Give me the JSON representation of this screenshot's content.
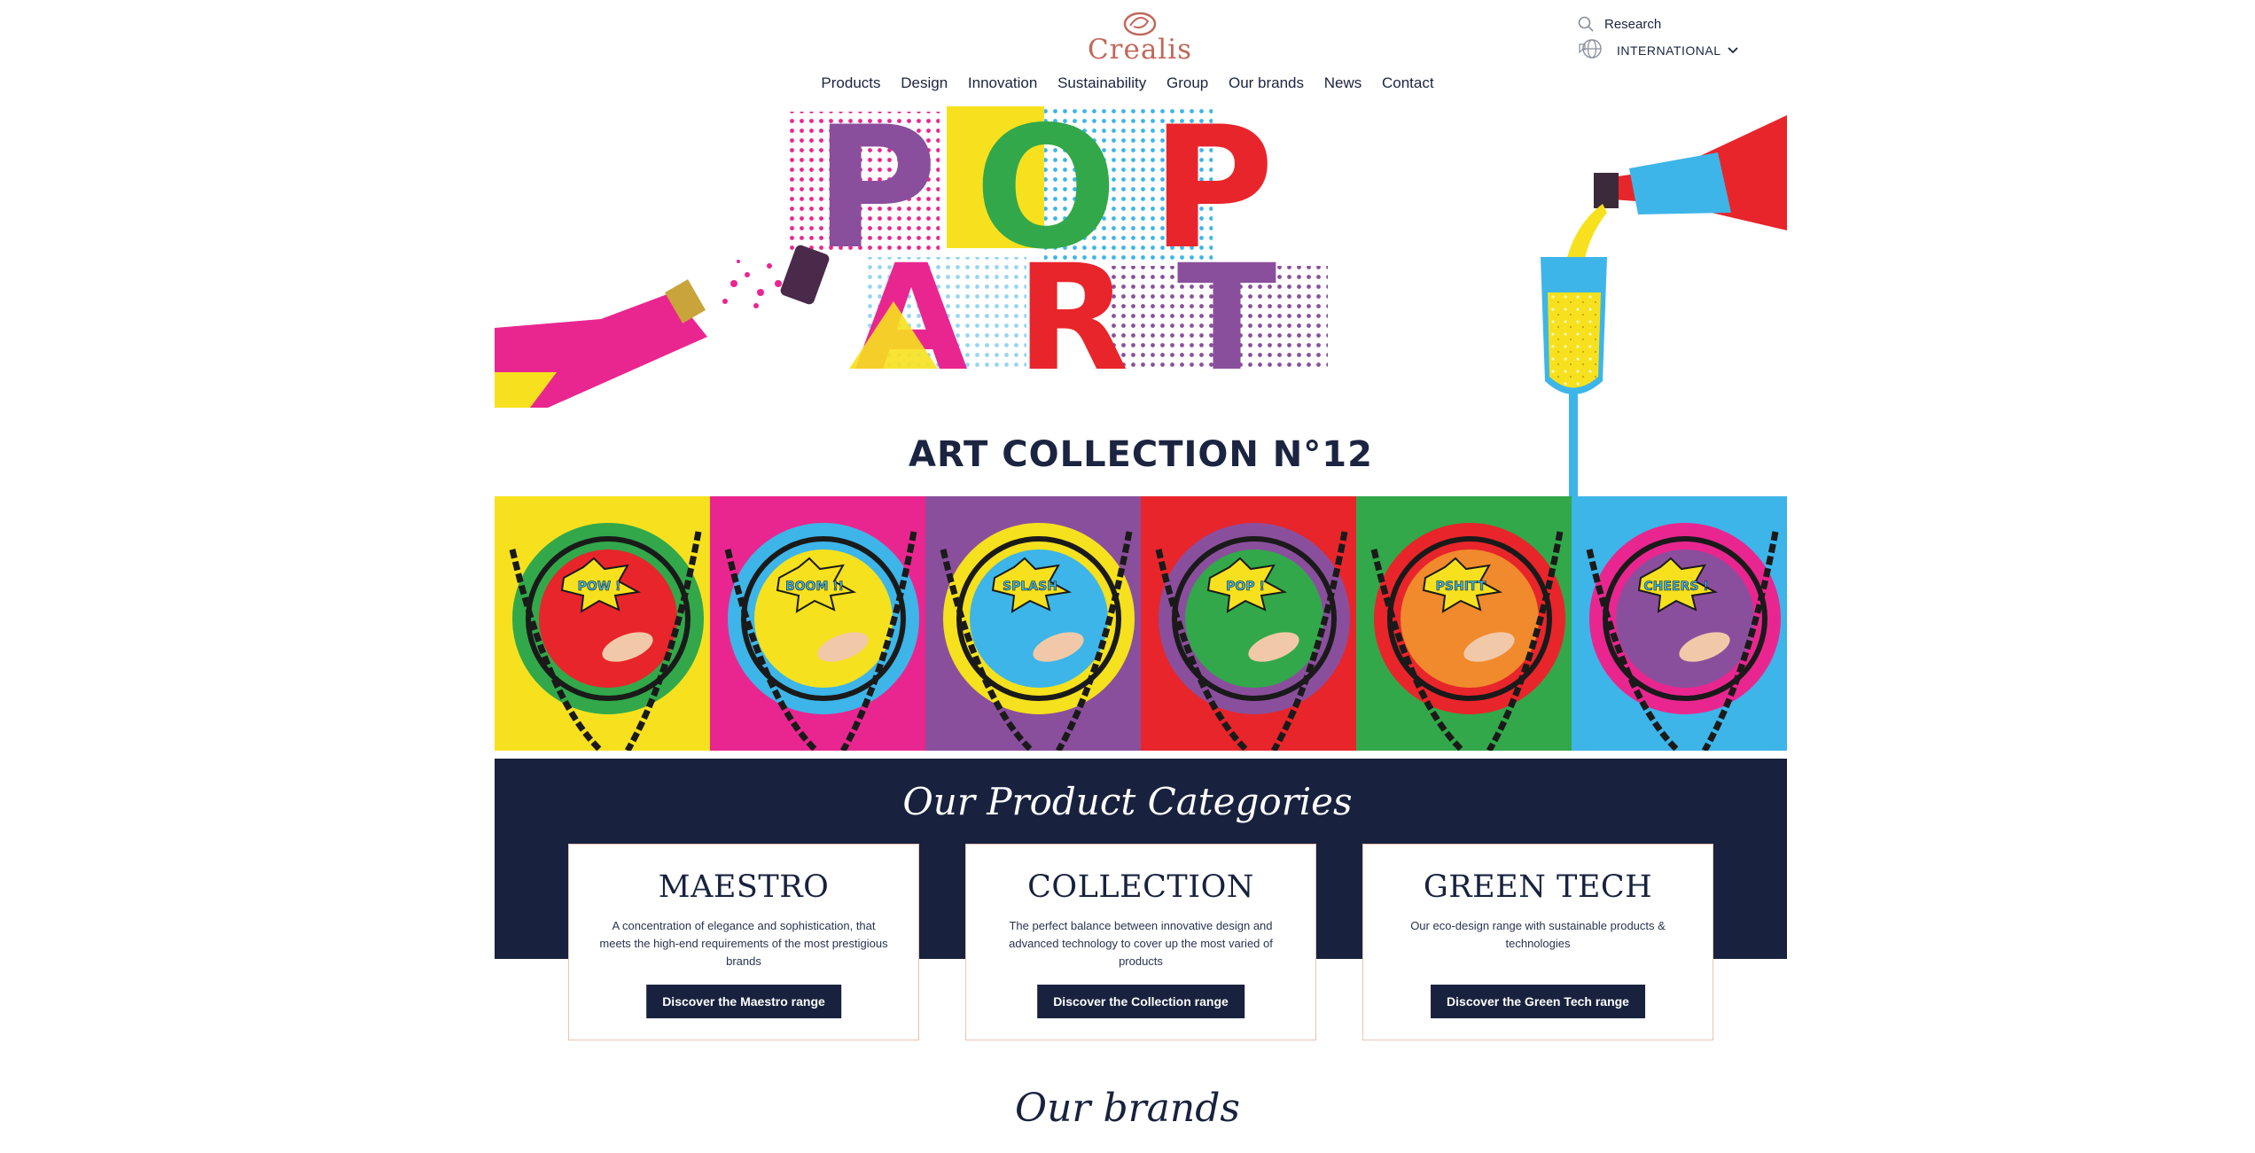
{
  "header": {
    "logo_text": "Crealis",
    "research_label": "Research",
    "language_label": "INTERNATIONAL",
    "nav": [
      "Products",
      "Design",
      "Innovation",
      "Sustainability",
      "Group",
      "Our brands",
      "News",
      "Contact"
    ]
  },
  "hero": {
    "letters": [
      "P",
      "O",
      "P",
      "A",
      "R",
      "T"
    ],
    "title": "ART COLLECTION N°12",
    "tiles": [
      {
        "bg": "#f7e11e",
        "ring": "#32a84a",
        "center": "#e8252b",
        "label": "POW !"
      },
      {
        "bg": "#e9268f",
        "ring": "#3db5e8",
        "center": "#f5e11d",
        "label": "BOOM !!"
      },
      {
        "bg": "#8a4f9c",
        "ring": "#f5e11d",
        "center": "#3db5e8",
        "label": "SPLASH"
      },
      {
        "bg": "#e8252b",
        "ring": "#8a4f9c",
        "center": "#32a84a",
        "label": "POP !"
      },
      {
        "bg": "#32a84a",
        "ring": "#e8252b",
        "center": "#f08a2c",
        "label": "PSHITT"
      },
      {
        "bg": "#3db5e8",
        "ring": "#e9268f",
        "center": "#8a4f9c",
        "label": "CHEERS !"
      }
    ]
  },
  "categories": {
    "heading": "Our Product Categories",
    "cards": [
      {
        "title": "MAESTRO",
        "description": "A concentration of elegance and sophistication, that meets the high-end requirements of the most prestigious brands",
        "button": "Discover the Maestro range"
      },
      {
        "title": "COLLECTION",
        "description": "The perfect balance between innovative design and advanced technology to cover up the most varied of products",
        "button": "Discover the Collection range"
      },
      {
        "title": "GREEN TECH",
        "description": "Our eco-design range with sustainable products & technologies",
        "button": "Discover the Green Tech range"
      }
    ]
  },
  "brands": {
    "heading": "Our brands"
  },
  "colors": {
    "navy": "#18223e",
    "logo": "#c0685a",
    "pop_pink": "#e9268f",
    "pop_yellow": "#f7e11e",
    "pop_blue": "#3db5e8",
    "pop_purple": "#8a4f9c",
    "pop_red": "#e8252b",
    "pop_green": "#32a84a"
  }
}
